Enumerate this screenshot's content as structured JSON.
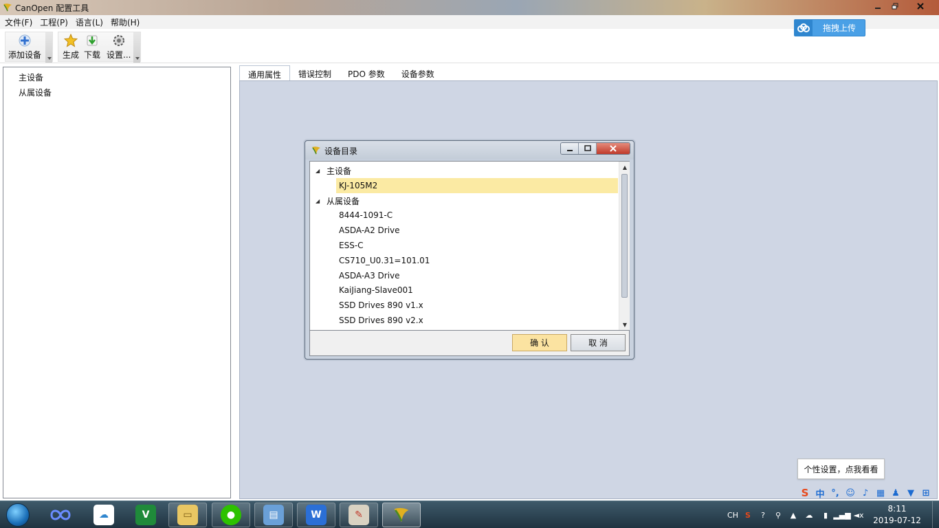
{
  "window": {
    "title": "CanOpen 配置工具"
  },
  "menu": [
    "文件(F)",
    "工程(P)",
    "语言(L)",
    "帮助(H)"
  ],
  "toolbar": {
    "add_device": "添加设备",
    "generate": "生成",
    "download": "下载",
    "settings": "设置..."
  },
  "upload": {
    "label": "拖拽上传"
  },
  "left_tree": {
    "master": "主设备",
    "slave": "从属设备"
  },
  "tabs": [
    "通用属性",
    "错误控制",
    "PDO 参数",
    "设备参数"
  ],
  "dialog": {
    "title": "设备目录",
    "master_group": "主设备",
    "master_items": [
      "KJ-105M2"
    ],
    "slave_group": "从属设备",
    "slave_items": [
      "8444-1091-C",
      "ASDA-A2 Drive",
      "ESS-C",
      "CS710_U0.31=101.01",
      "ASDA-A3 Drive",
      "KaiJiang-Slave001",
      "SSD Drives 890 v1.x",
      "SSD Drives 890 v2.x"
    ],
    "ok": "确 认",
    "cancel": "取 消"
  },
  "tooltip": "个性设置，点我看看",
  "ime": {
    "lang": "中"
  },
  "tray": {
    "input_lang": "CH"
  },
  "clock": {
    "time": "8:11",
    "date": "2019-07-12"
  },
  "colors": {
    "selected_row": "#fbeaa3",
    "content_bg": "#cfd6e4",
    "upload_accent": "#4aa0e6"
  }
}
